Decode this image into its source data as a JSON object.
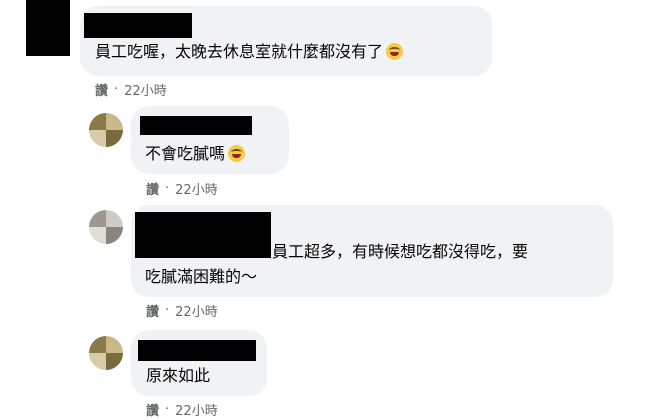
{
  "colors": {
    "bubble_bg": "#f0f2f5",
    "meta_text": "#65676b",
    "redaction": "#000000"
  },
  "comments": [
    {
      "text": "員工吃喔，太晚去休息室就什麼都沒有了",
      "emoji": "grinning-face",
      "like_label": "讚",
      "time": "22小時"
    },
    {
      "text": "不會吃膩嗎",
      "emoji": "grinning-face",
      "like_label": "讚",
      "time": "22小時"
    },
    {
      "text_line1": "員工超多，有時候想吃都沒得吃，要",
      "text_line2": "吃膩滿困難的～",
      "like_label": "讚",
      "time": "22小時"
    },
    {
      "text": "原來如此",
      "like_label": "讚",
      "time": "22小時"
    }
  ]
}
